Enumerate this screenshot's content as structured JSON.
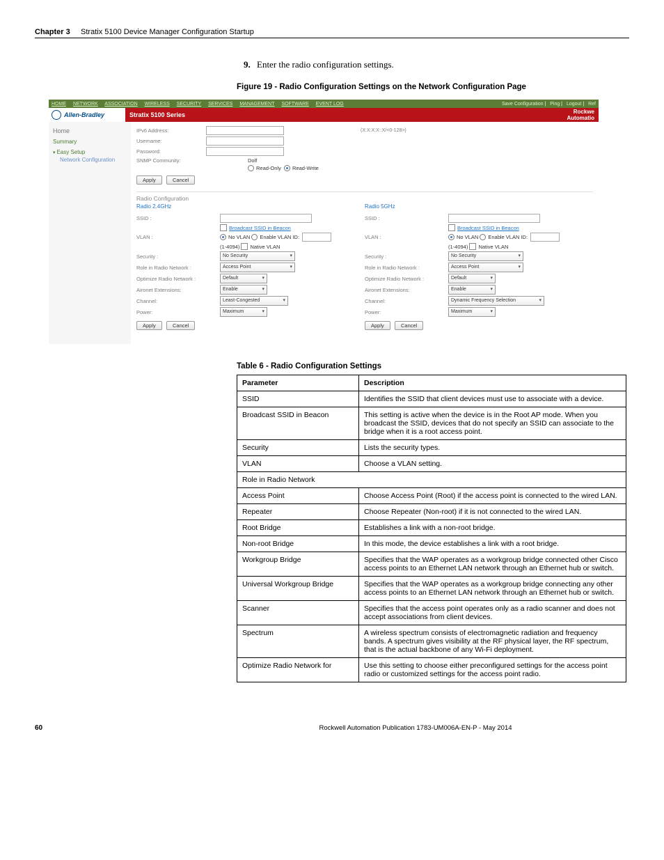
{
  "header": {
    "chapter": "Chapter 3",
    "title": "Stratix 5100 Device Manager Configuration Startup"
  },
  "step": {
    "num": "9.",
    "text": "Enter the radio configuration settings."
  },
  "figure_caption": "Figure 19 - Radio Configuration Settings on the Network Configuration Page",
  "table_caption": "Table 6 - Radio Configuration Settings",
  "footer": {
    "page": "60",
    "pub": "Rockwell Automation Publication 1783-UM006A-EN-P - May 2014"
  },
  "shot": {
    "nav": [
      "HOME",
      "NETWORK",
      "ASSOCIATION",
      "WIRELESS",
      "SECURITY",
      "SERVICES",
      "MANAGEMENT",
      "SOFTWARE",
      "EVENT LOG"
    ],
    "right_links": [
      "Save Configuration",
      "Ping",
      "Logout",
      "Ref"
    ],
    "brand": "Allen-Bradley",
    "title": "Stratix 5100 Series",
    "rockw_1": "Rockwe",
    "rockw_2": "Automatio",
    "sidebar": {
      "home": "Home",
      "summary": "Summary",
      "easy": "Easy Setup",
      "sub": "Network Configuration"
    },
    "upper": {
      "ipv6": "IPv6 Address:",
      "ipv6_hint": "(X:X:X:X::X/<0-128>)",
      "user": "Username:",
      "pass": "Password:",
      "snmp": "SNMP Community:",
      "snmp_val": "Dolf",
      "ro": "Read-Only",
      "rw": "Read-Write",
      "apply": "Apply",
      "cancel": "Cancel"
    },
    "section": "Radio Configuration",
    "col24": "Radio 2.4GHz",
    "col5": "Radio 5GHz",
    "f": {
      "ssid": "SSID :",
      "bcast": "Broadcast SSID in Beacon",
      "vlan": "VLAN :",
      "novlan": "No VLAN",
      "enablevlan": "Enable VLAN ID:",
      "vlanrange": "(1-4094)",
      "nativevlan": "Native VLAN",
      "security": "Security :",
      "nosec": "No Security",
      "role": "Role in Radio Network :",
      "ap": "Access Point",
      "opt": "Optimize Radio Network :",
      "default": "Default",
      "aironet": "Aironet Extensions:",
      "enable": "Enable",
      "channel": "Channel:",
      "least": "Least-Congested",
      "dfs": "Dynamic Frequency Selection",
      "power": "Power:",
      "max": "Maximum"
    }
  },
  "table": {
    "head": [
      "Parameter",
      "Description"
    ],
    "rows": [
      [
        "SSID",
        "Identifies the SSID that client devices must use to associate with a device."
      ],
      [
        "Broadcast SSID in Beacon",
        "This setting is active when the device is in the Root AP mode. When you broadcast the SSID, devices that do not specify an SSID can associate to the bridge when it is a root access point."
      ],
      [
        "Security",
        "Lists the security types."
      ],
      [
        "VLAN",
        "Choose a VLAN setting."
      ],
      [
        "Role in Radio Network",
        ""
      ],
      [
        "Access Point",
        "Choose Access Point (Root) if the access point is connected to the wired LAN."
      ],
      [
        "Repeater",
        "Choose Repeater (Non-root) if it is not connected to the wired LAN."
      ],
      [
        "Root Bridge",
        "Establishes a link with a non-root bridge."
      ],
      [
        "Non-root Bridge",
        "In this mode, the device establishes a link with a root bridge."
      ],
      [
        "Workgroup Bridge",
        "Specifies that the WAP operates as a workgroup bridge connected other Cisco access points to an Ethernet LAN network through an Ethernet hub or switch."
      ],
      [
        "Universal Workgroup Bridge",
        "Specifies that the WAP operates as a workgroup bridge connecting any other access points to an Ethernet LAN network through an Ethernet hub or switch."
      ],
      [
        "Scanner",
        "Specifies that the access point operates only as a radio scanner and does not accept associations from client devices."
      ],
      [
        "Spectrum",
        "A wireless spectrum consists of electromagnetic radiation and frequency bands. A spectrum gives visibility at the RF physical layer, the RF spectrum, that is the actual backbone of any Wi-Fi deployment."
      ],
      [
        "Optimize Radio Network for",
        "Use this setting to choose either preconfigured settings for the access point radio or customized settings for the access point radio."
      ]
    ]
  }
}
